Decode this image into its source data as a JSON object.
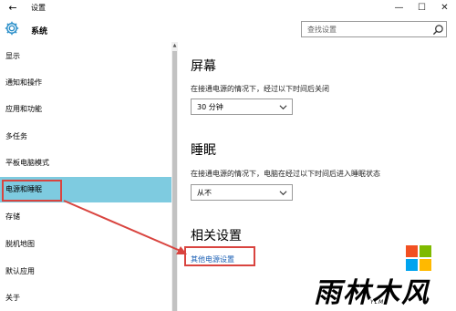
{
  "window": {
    "title": "设置",
    "back_glyph": "←",
    "minimize_glyph": "—",
    "maximize_glyph": "☐",
    "close_glyph": "✕"
  },
  "header": {
    "title": "系统",
    "search_placeholder": "查找设置"
  },
  "sidebar": {
    "items": [
      {
        "label": "显示"
      },
      {
        "label": "通知和操作"
      },
      {
        "label": "应用和功能"
      },
      {
        "label": "多任务"
      },
      {
        "label": "平板电脑模式"
      },
      {
        "label": "电源和睡眠",
        "selected": true
      },
      {
        "label": "存储"
      },
      {
        "label": "脱机地图"
      },
      {
        "label": "默认应用"
      },
      {
        "label": "关于"
      }
    ]
  },
  "main": {
    "screen": {
      "title": "屏幕",
      "description": "在接通电源的情况下，经过以下时间后关闭",
      "value": "30 分钟"
    },
    "sleep": {
      "title": "睡眠",
      "description": "在接通电源的情况下，电脑在经过以下时间后进入睡眠状态",
      "value": "从不"
    },
    "related": {
      "title": "相关设置",
      "link": "其他电源设置"
    }
  },
  "watermark": {
    "text": "雨林木风",
    "sub": "YLMF"
  },
  "colors": {
    "selected_bg": "#7ecbe0",
    "highlight_border": "#d9443f",
    "link": "#1a5fb4",
    "gear": "#2b8fc9"
  }
}
